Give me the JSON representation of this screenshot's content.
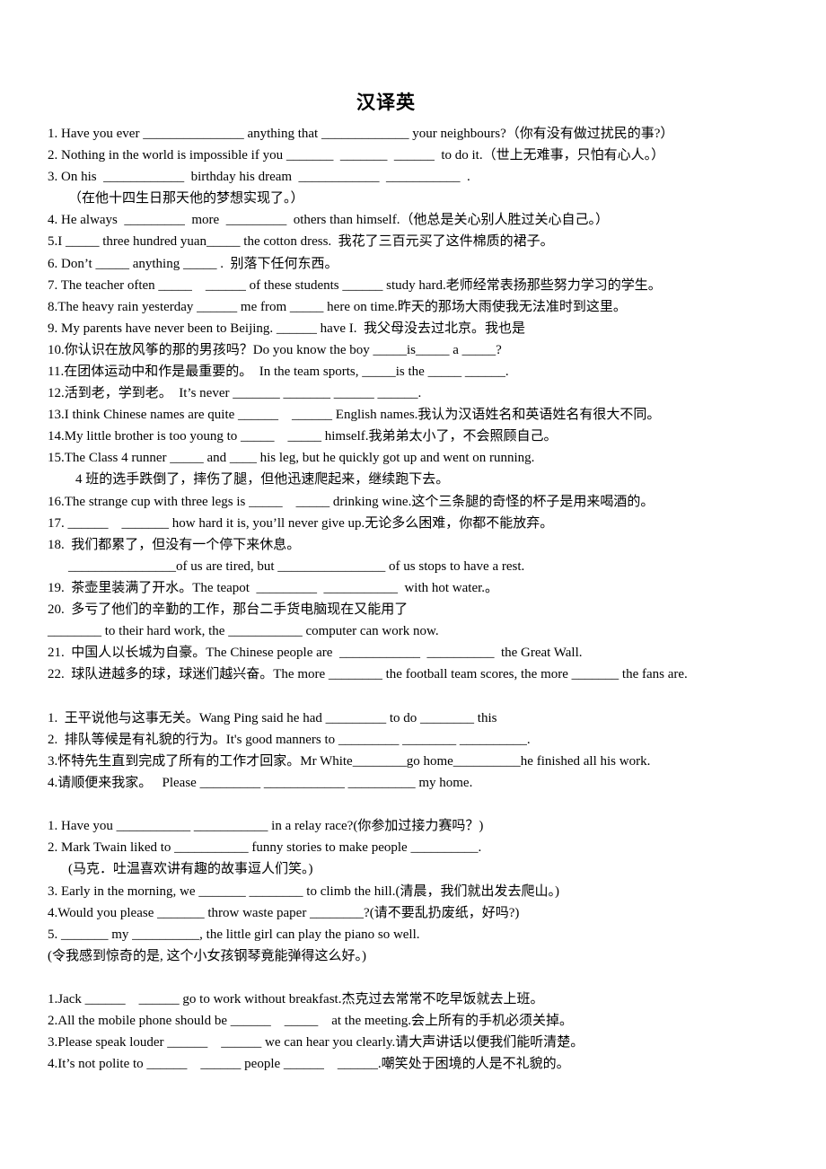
{
  "title": "汉译英",
  "sections": [
    {
      "lines": [
        "1. Have you ever _______________ anything that _____________ your neighbours?（你有没有做过扰民的事?）",
        "2. Nothing in the world is impossible if you _______  _______  ______  to do it.（世上无难事，只怕有心人。）",
        "3. On his  ____________  birthday his dream  ____________  ___________  .",
        "（在他十四生日那天他的梦想实现了。）",
        "4. He always  _________  more  _________  others than himself.（他总是关心别人胜过关心自己。）",
        "5.I _____ three hundred yuan_____ the cotton dress.  我花了三百元买了这件棉质的裙子。",
        "6. Don’t _____ anything _____ .  别落下任何东西。",
        "7. The teacher often _____    ______ of these students ______ study hard.老师经常表扬那些努力学习的学生。",
        "8.The heavy rain yesterday ______ me from _____ here on time.昨天的那场大雨使我无法准时到这里。",
        "9. My parents have never been to Beijing. ______ have I.  我父母没去过北京。我也是",
        "10.你认识在放风筝的那的男孩吗？Do you know the boy _____is_____ a _____?",
        "11.在团体运动中和作是最重要的。  In the team sports, _____is the _____ ______.",
        "12.活到老，学到老。  It’s never _______ _______ ______ ______.",
        "13.I think Chinese names are quite ______    ______ English names.我认为汉语姓名和英语姓名有很大不同。",
        "14.My little brother is too young to _____    _____ himself.我弟弟太小了，不会照顾自己。",
        "15.The Class 4 runner _____ and ____ his leg, but he quickly got up and went on running.",
        "4 班的选手跌倒了，摔伤了腿，但他迅速爬起来，继续跑下去。",
        "16.The strange cup with three legs is _____    _____ drinking wine.这个三条腿的奇怪的杯子是用来喝酒的。",
        "17. ______    _______ how hard it is, you’ll never give up.无论多么困难，你都不能放弃。",
        "18.  我们都累了，但没有一个停下来休息。",
        "________________of us are tired, but ________________ of us stops to have a rest.",
        "19.  茶壶里装满了开水。The teapot  _________  ___________  with hot water.。",
        "20.  多亏了他们的辛勤的工作，那台二手货电脑现在又能用了",
        "________ to their hard work, the ___________ computer can work now.",
        "21.  中国人以长城为自豪。The Chinese people are  ____________  __________  the Great Wall.",
        "22.  球队进越多的球，球迷们越兴奋。The more ________ the football team scores, the more _______ the fans are."
      ]
    },
    {
      "lines": [
        "1.  王平说他与这事无关。Wang Ping said he had _________ to do ________ this",
        "2.  排队等候是有礼貌的行为。It's good manners to _________ ________ __________.",
        "3.怀特先生直到完成了所有的工作才回家。Mr White________go home__________he finished all his work.",
        "4.请顺便来我家。   Please _________ ____________ __________ my home."
      ]
    },
    {
      "lines": [
        "1. Have you ___________ ___________ in a relay race?(你参加过接力赛吗？)",
        "2. Mark Twain liked to ___________ funny stories to make people __________.",
        "(马克．吐温喜欢讲有趣的故事逗人们笑。)",
        "3. Early in the morning, we _______ ________ to climb the hill.(清晨，我们就出发去爬山。)",
        "4.Would you please _______ throw waste paper ________?(请不要乱扔废纸，好吗?)",
        "5. _______ my __________, the little girl can play the piano so well.",
        "(令我感到惊奇的是, 这个小女孩钢琴竟能弹得这么好。)"
      ]
    },
    {
      "lines": [
        "1.Jack ______    ______ go to work without breakfast.杰克过去常常不吃早饭就去上班。",
        "2.All the mobile phone should be ______    _____    at the meeting.会上所有的手机必须关掉。",
        "3.Please speak louder ______    ______ we can hear you clearly.请大声讲话以便我们能听清楚。",
        "4.It’s not polite to ______    ______ people ______    ______.嘲笑处于困境的人是不礼貌的。"
      ]
    }
  ]
}
